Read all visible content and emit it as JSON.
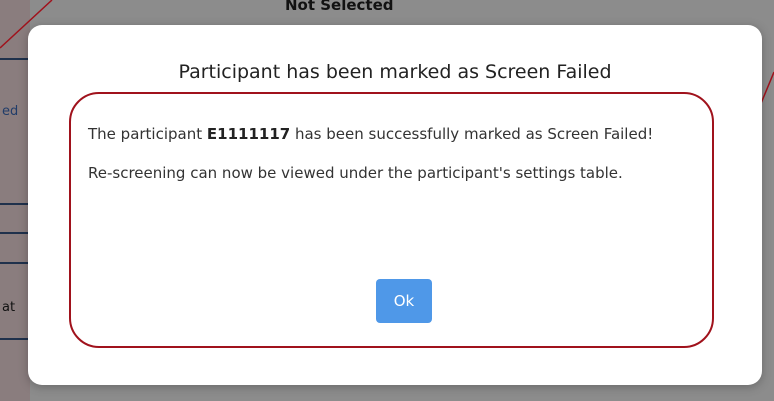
{
  "background": {
    "header_text": "Not Selected",
    "fragments": {
      "f1": "ed",
      "f2": "at"
    }
  },
  "modal": {
    "title": "Participant has been marked as Screen Failed",
    "message_prefix": "The participant ",
    "participant_id": "E1111117",
    "message_suffix": " has been successfully marked as Screen Failed!",
    "rescreen_message": "Re-screening can now be viewed under the participant's settings table.",
    "ok_label": "Ok"
  },
  "colors": {
    "ok_button": "#4f98e8",
    "annotation": "#a0121c",
    "left_panel": "#fbe3e6"
  }
}
